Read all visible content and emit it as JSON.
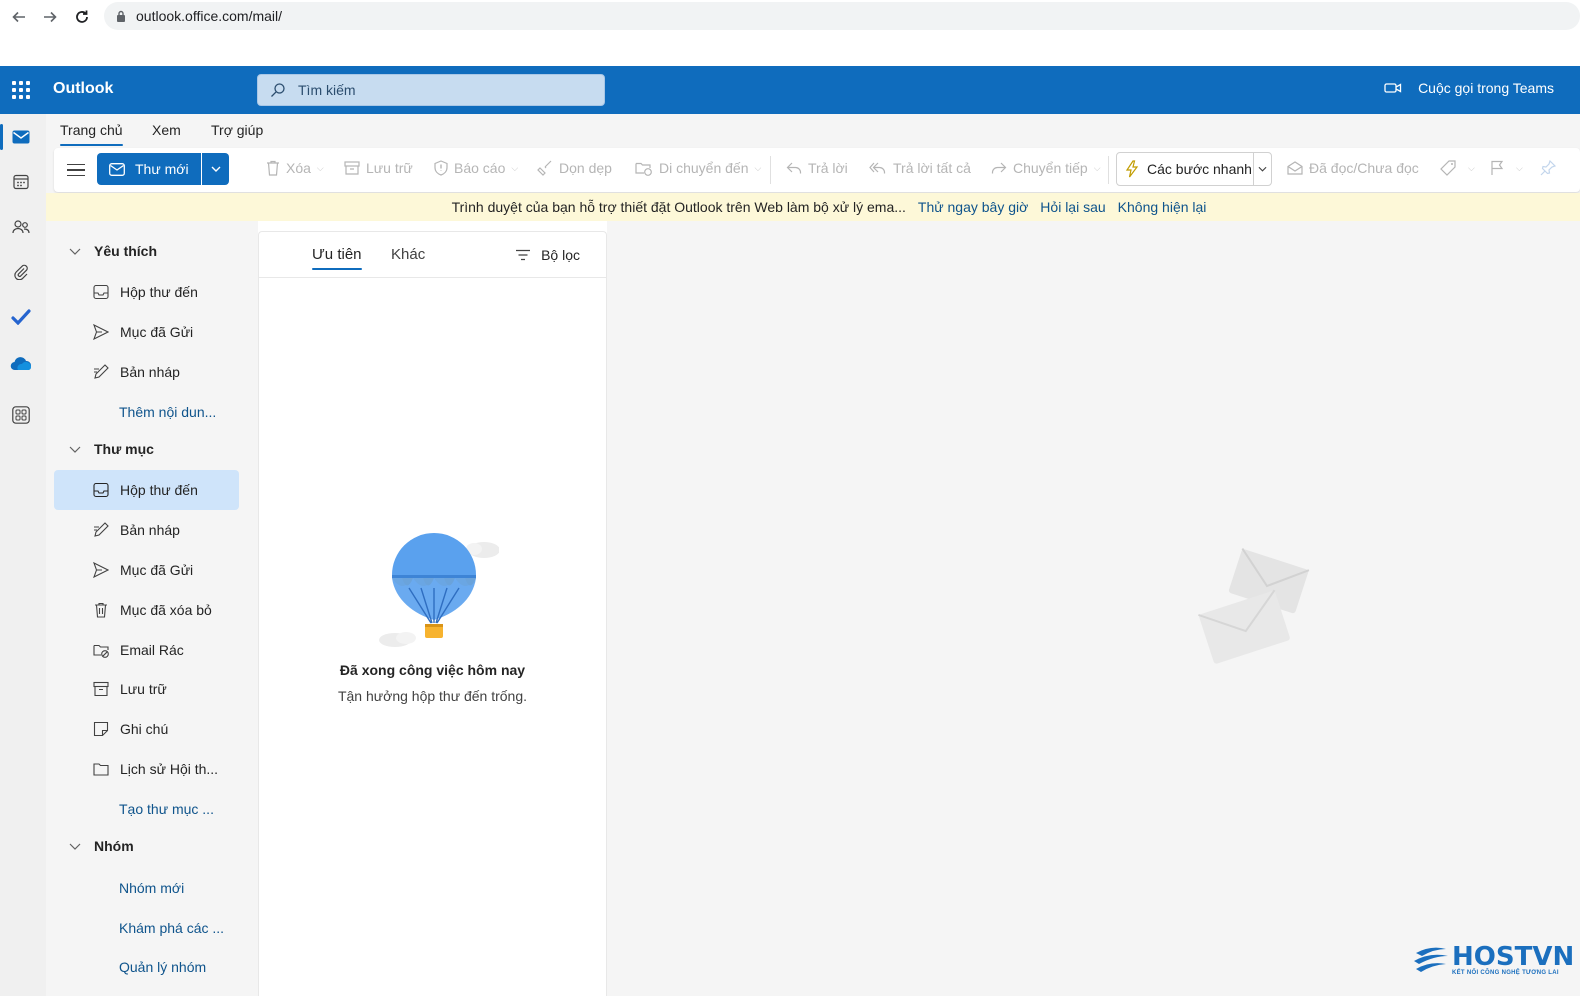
{
  "browser": {
    "url": "outlook.office.com/mail/"
  },
  "header": {
    "app_name": "Outlook",
    "search_placeholder": "Tìm kiếm",
    "teams_call_label": "Cuộc gọi trong Teams"
  },
  "ribbon_tabs": [
    {
      "label": "Trang chủ",
      "active": true
    },
    {
      "label": "Xem",
      "active": false
    },
    {
      "label": "Trợ giúp",
      "active": false
    }
  ],
  "toolbar": {
    "new_mail_label": "Thư mới",
    "delete_label": "Xóa",
    "archive_label": "Lưu trữ",
    "report_label": "Báo cáo",
    "sweep_label": "Dọn dẹp",
    "move_label": "Di chuyển đến",
    "reply_label": "Trả lời",
    "reply_all_label": "Trả lời tất cả",
    "forward_label": "Chuyển tiếp",
    "quick_steps_label": "Các bước nhanh",
    "read_unread_label": "Đã đọc/Chưa đọc"
  },
  "banner": {
    "message": "Trình duyệt của bạn hỗ trợ thiết đặt Outlook trên Web làm bộ xử lý ema...",
    "try_now": "Thử ngay bây giờ",
    "ask_later": "Hỏi lại sau",
    "dont_show": "Không hiện lại"
  },
  "folder_pane": {
    "favorites": {
      "title": "Yêu thích",
      "items": [
        "Hộp thư đến",
        "Mục đã Gửi",
        "Bản nháp"
      ],
      "add_link": "Thêm nội dun..."
    },
    "folders": {
      "title": "Thư mục",
      "items": [
        "Hộp thư đến",
        "Bản nháp",
        "Mục đã Gửi",
        "Mục đã xóa bỏ",
        "Email Rác",
        "Lưu trữ",
        "Ghi chú",
        "Lịch sử Hội th..."
      ],
      "selected_index": 0,
      "create_link": "Tạo thư mục ..."
    },
    "groups": {
      "title": "Nhóm",
      "links": [
        "Nhóm mới",
        "Khám phá các ...",
        "Quản lý nhóm"
      ]
    }
  },
  "message_list": {
    "tabs": [
      "Ưu tiên",
      "Khác"
    ],
    "active_tab": 0,
    "filter_label": "Bộ lọc",
    "empty_title": "Đã xong công việc hôm nay",
    "empty_subtitle": "Tận hưởng hộp thư đến trống."
  },
  "watermark": {
    "brand": "HOSTVN",
    "tagline": "KẾT NỐI CÔNG NGHỆ TƯƠNG LAI"
  },
  "colors": {
    "header_blue": "#0f6cbd",
    "selected_folder": "#cfe4fa",
    "banner_bg": "#fdf8d8",
    "link_blue": "#0f548c"
  }
}
